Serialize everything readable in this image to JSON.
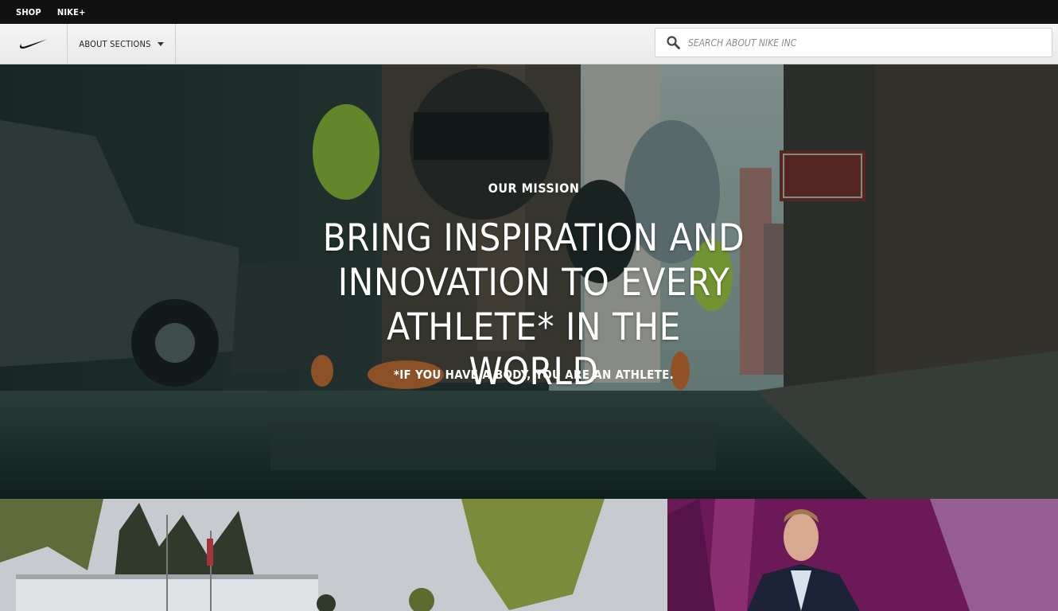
{
  "topbar": {
    "links": [
      "SHOP",
      "NIKE+"
    ]
  },
  "nav": {
    "logo_icon": "nike-swoosh-icon",
    "sections_label": "ABOUT SECTIONS",
    "search_placeholder": "SEARCH ABOUT NIKE INC",
    "search_icon": "search-icon"
  },
  "hero": {
    "kicker": "OUR MISSION",
    "headline": "BRING INSPIRATION AND INNOVATION TO EVERY ATHLETE* IN THE WORLD",
    "footnote": "*IF YOU HAVE A BODY, YOU ARE AN ATHLETE."
  },
  "colors": {
    "topbar": "#111111",
    "nav": "#efefef",
    "hero_tint": "#1f3532",
    "ceo_tile": "#6a1a56"
  }
}
